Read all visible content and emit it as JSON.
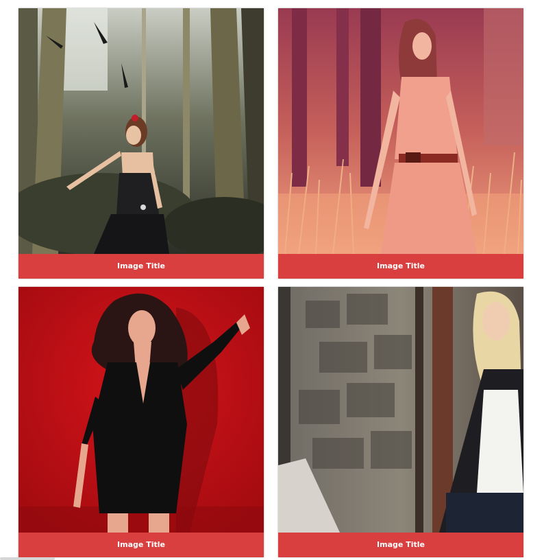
{
  "theme": {
    "caption_bg": "#d93f3f",
    "caption_text": "#ffffff"
  },
  "gallery": {
    "items": [
      {
        "title": "Image Title",
        "photo": "woman-in-forest-black-dress"
      },
      {
        "title": "Image Title",
        "photo": "woman-in-field-red-tint"
      },
      {
        "title": "Image Title",
        "photo": "woman-black-blazer-red-wall"
      },
      {
        "title": "Image Title",
        "photo": "blonde-woman-stone-street"
      }
    ]
  }
}
